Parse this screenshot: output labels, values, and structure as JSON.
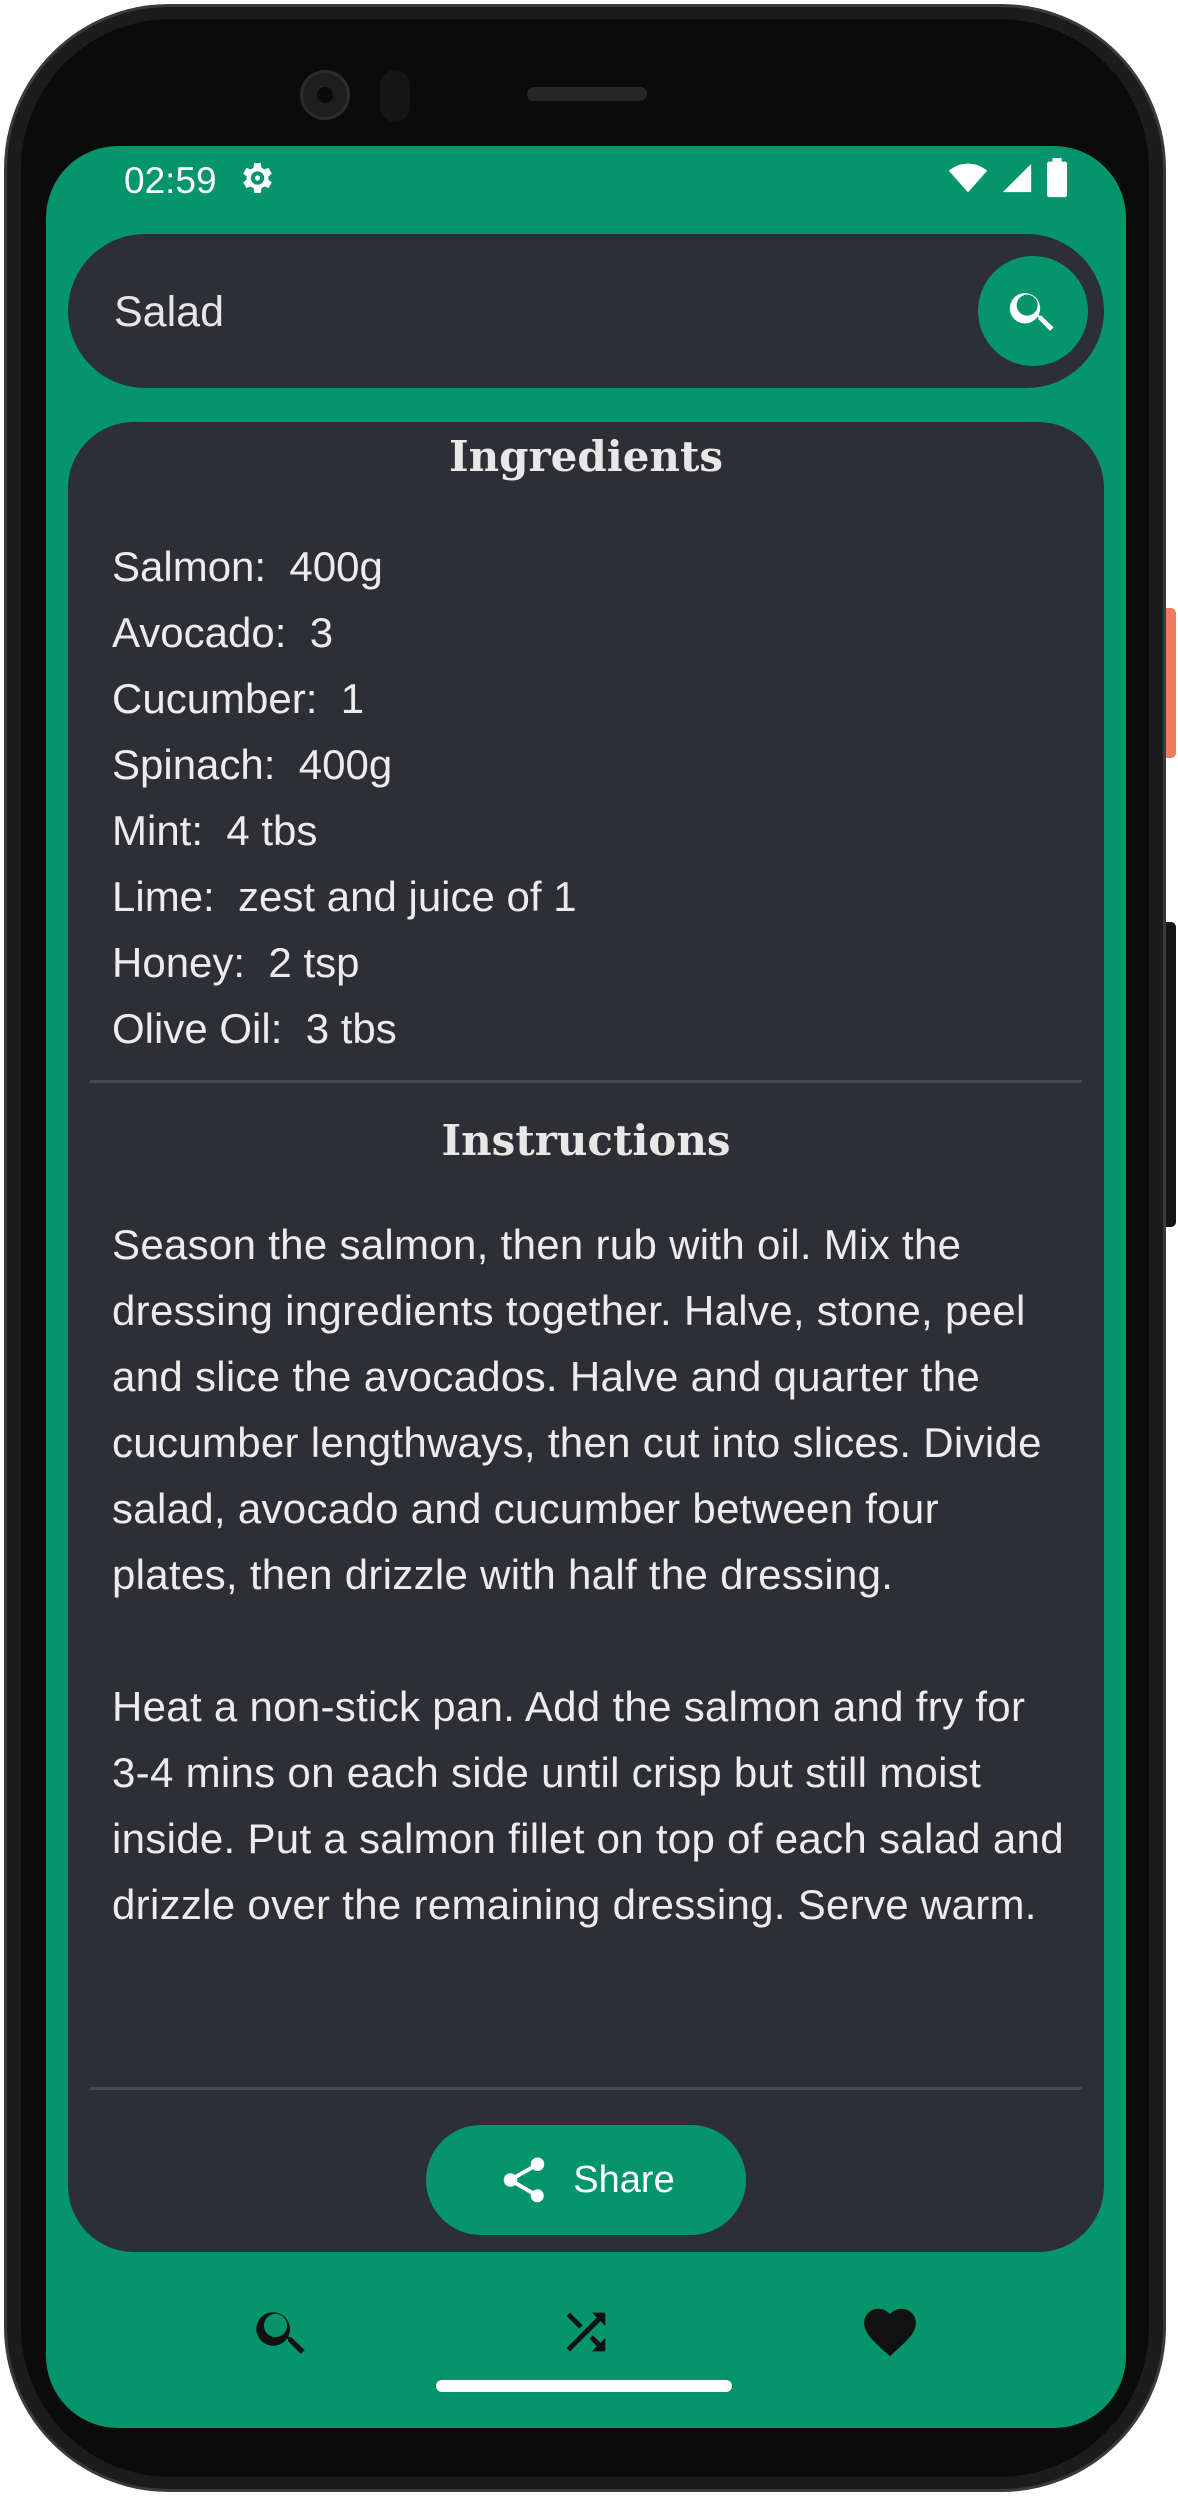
{
  "status_bar": {
    "time": "02:59",
    "icons": [
      "settings-gear-icon",
      "wifi-icon",
      "signal-icon",
      "battery-icon"
    ]
  },
  "search": {
    "value": "Salad",
    "button_icon": "search-icon"
  },
  "ingredients": {
    "title": "Ingredients",
    "items": [
      "Salmon:  400g",
      "Avocado:  3",
      "Cucumber:  1",
      "Spinach:  400g",
      "Mint:  4 tbs",
      "Lime:  zest and juice of 1",
      "Honey:  2 tsp",
      "Olive Oil:  3 tbs"
    ]
  },
  "instructions": {
    "title": "Instructions",
    "paragraphs": [
      "Season the salmon, then rub with oil. Mix the dressing ingredients together. Halve, stone, peel and slice the avocados. Halve and quarter the cucumber lengthways, then cut into slices. Divide salad, avocado and cucumber between four plates, then drizzle with half the dressing.",
      "Heat a non-stick pan. Add the salmon and fry for 3-4 mins on each side until crisp but still moist inside. Put a salmon fillet on top of each salad and drizzle over the remaining dressing. Serve warm."
    ]
  },
  "share": {
    "label": "Share",
    "icon": "share-icon"
  },
  "bottom_nav": [
    {
      "icon": "search-icon"
    },
    {
      "icon": "shuffle-icon"
    },
    {
      "icon": "heart-icon"
    }
  ],
  "colors": {
    "accent": "#05956a",
    "card": "#2d2f35",
    "text": "#ececec"
  }
}
